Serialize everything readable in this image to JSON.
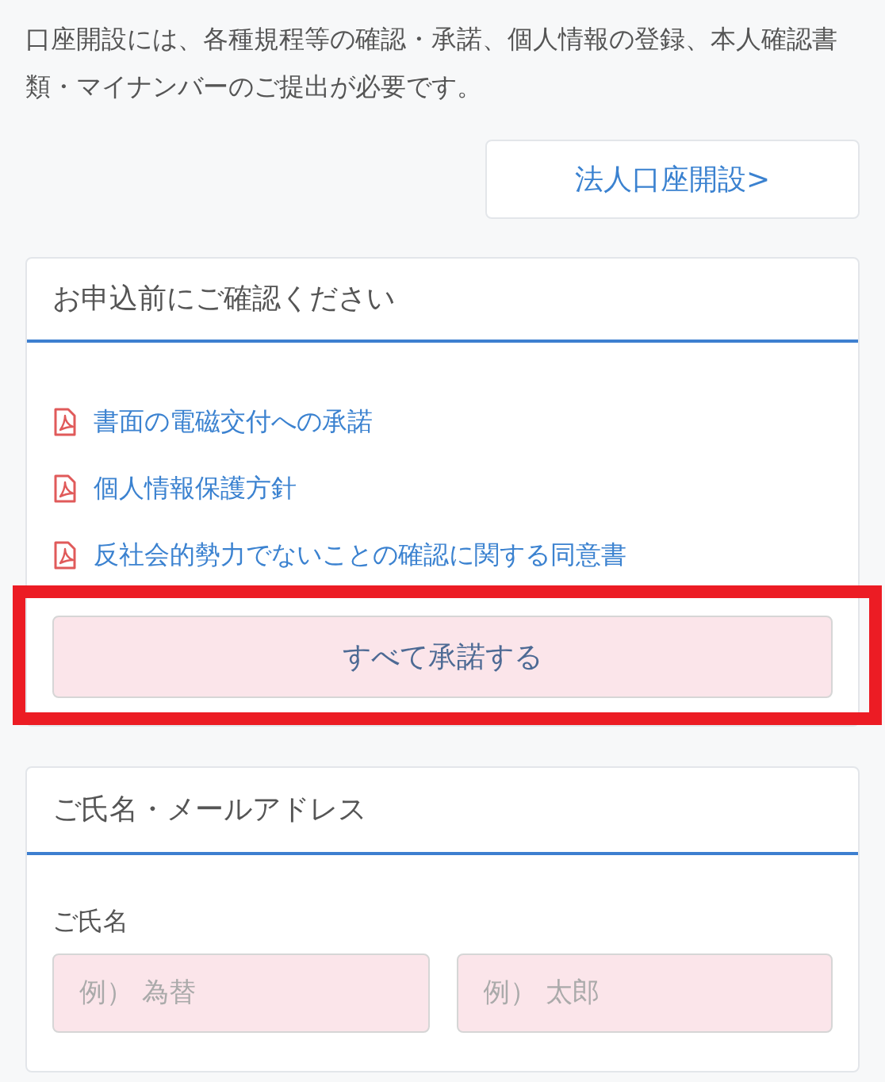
{
  "intro": "口座開設には、各種規程等の確認・承諾、個人情報の登録、本人確認書類・マイナンバーのご提出が必要です。",
  "corporate_button": {
    "label": "法人口座開設>"
  },
  "confirm_section": {
    "title": "お申込前にご確認ください",
    "documents": [
      {
        "label": "書面の電磁交付への承諾"
      },
      {
        "label": "個人情報保護方針"
      },
      {
        "label": "反社会的勢力でないことの確認に関する同意書"
      }
    ],
    "accept_button": {
      "label": "すべて承諾する",
      "highlighted": true
    }
  },
  "name_section": {
    "title": "ご氏名・メールアドレス",
    "field_label": "ご氏名",
    "fields": [
      {
        "placeholder": "例） 為替"
      },
      {
        "placeholder": "例） 太郎"
      }
    ]
  }
}
